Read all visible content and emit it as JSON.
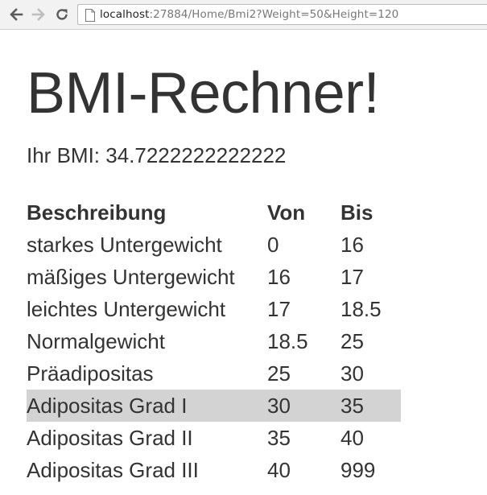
{
  "browser": {
    "url_host": "localhost",
    "url_rest": ":27884/Home/Bmi2?Weight=50&Height=120"
  },
  "page": {
    "title": "BMI-Rechner!",
    "result": "Ihr BMI: 34.7222222222222"
  },
  "table": {
    "headers": [
      "Beschreibung",
      "Von",
      "Bis"
    ],
    "rows": [
      [
        "starkes Untergewicht",
        "0",
        "16"
      ],
      [
        "mäßiges Untergewicht",
        "16",
        "17"
      ],
      [
        "leichtes Untergewicht",
        "17",
        "18.5"
      ],
      [
        "Normalgewicht",
        "18.5",
        "25"
      ],
      [
        "Präadipositas",
        "25",
        "30"
      ],
      [
        "Adipositas Grad I",
        "30",
        "35"
      ],
      [
        "Adipositas Grad II",
        "35",
        "40"
      ],
      [
        "Adipositas Grad III",
        "40",
        "999"
      ]
    ],
    "highlighted_row": 5
  },
  "colors": {
    "highlight": "#d3d3d3",
    "text": "#333333"
  },
  "icons": [
    "back-arrow-icon",
    "forward-arrow-icon",
    "reload-icon",
    "page-icon"
  ]
}
